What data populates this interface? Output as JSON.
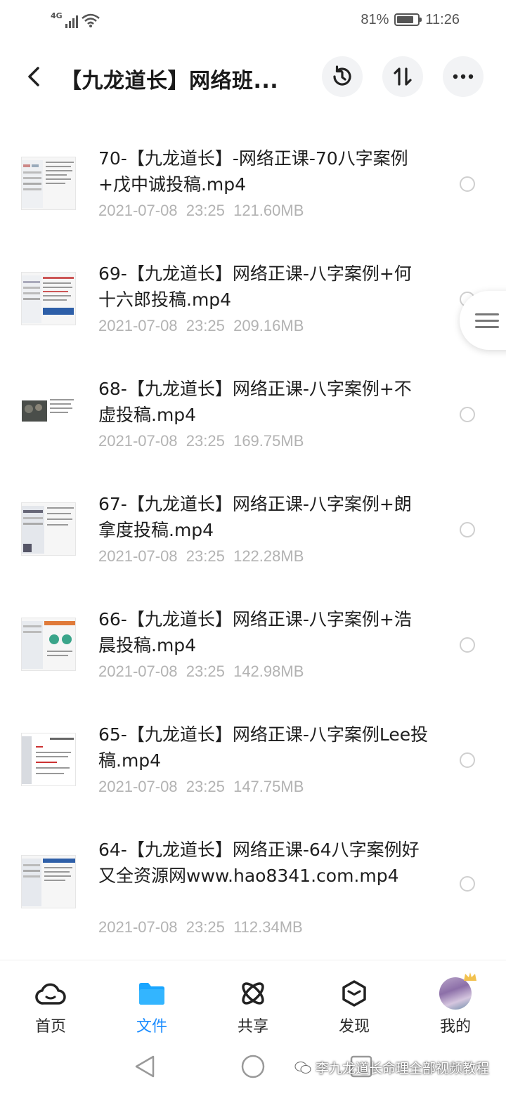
{
  "status_bar": {
    "network": "4G",
    "battery_percent": "81%",
    "battery_level": 0.81,
    "time": "11:26"
  },
  "header": {
    "title": "【九龙道长】网络班...",
    "back_icon": "chevron-left-icon",
    "history_icon": "history-icon",
    "sort_icon": "sort-icon",
    "more_icon": "more-horizontal-icon"
  },
  "files": [
    {
      "name": "70-【九龙道长】-网络正课-70八字案例+戊中诚投稿.mp4",
      "date": "2021-07-08",
      "time": "23:25",
      "size": "121.60MB"
    },
    {
      "name": "69-【九龙道长】网络正课-八字案例+何十六郎投稿.mp4",
      "date": "2021-07-08",
      "time": "23:25",
      "size": "209.16MB"
    },
    {
      "name": "68-【九龙道长】网络正课-八字案例+不虚投稿.mp4",
      "date": "2021-07-08",
      "time": "23:25",
      "size": "169.75MB"
    },
    {
      "name": "67-【九龙道长】网络正课-八字案例+朗拿度投稿.mp4",
      "date": "2021-07-08",
      "time": "23:25",
      "size": "122.28MB"
    },
    {
      "name": "66-【九龙道长】网络正课-八字案例+浩晨投稿.mp4",
      "date": "2021-07-08",
      "time": "23:25",
      "size": "142.98MB"
    },
    {
      "name": "65-【九龙道长】网络正课-八字案例Lee投稿.mp4",
      "date": "2021-07-08",
      "time": "23:25",
      "size": "147.75MB"
    },
    {
      "name": "64-【九龙道长】网络正课-64八字案例好又全资源网www.hao8341.com.mp4",
      "date": "2021-07-08",
      "time": "23:25",
      "size": "112.34MB"
    }
  ],
  "bottom_nav": [
    {
      "label": "首页",
      "icon": "cloud-icon",
      "active": false
    },
    {
      "label": "文件",
      "icon": "folder-icon",
      "active": true
    },
    {
      "label": "共享",
      "icon": "share-atom-icon",
      "active": false
    },
    {
      "label": "发现",
      "icon": "discover-cube-icon",
      "active": false
    },
    {
      "label": "我的",
      "icon": "avatar",
      "active": false
    }
  ],
  "watermark": "李九龙道长命理全部视频教程",
  "colors": {
    "accent": "#1a8cff",
    "meta_text": "#b3b3b3",
    "title_text": "#1a1a1a"
  }
}
